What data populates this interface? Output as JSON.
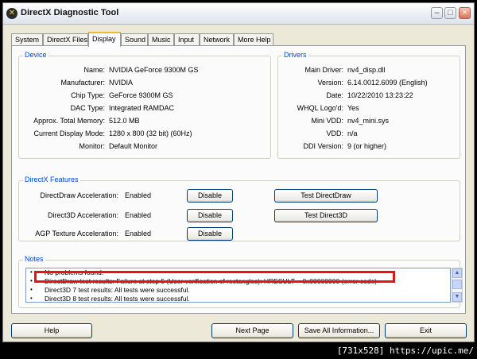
{
  "window": {
    "title": "DirectX Diagnostic Tool",
    "app_icon_glyph": "✕",
    "icons": [
      "directx-icon",
      "minimize-icon",
      "maximize-icon",
      "close-icon"
    ]
  },
  "tabs": [
    "System",
    "DirectX Files",
    "Display",
    "Sound",
    "Music",
    "Input",
    "Network",
    "More Help"
  ],
  "active_tab": "Display",
  "device": {
    "title": "Device",
    "rows": [
      {
        "label": "Name:",
        "value": "NVIDIA GeForce 9300M GS"
      },
      {
        "label": "Manufacturer:",
        "value": "NVIDIA"
      },
      {
        "label": "Chip Type:",
        "value": "GeForce 9300M GS"
      },
      {
        "label": "DAC Type:",
        "value": "Integrated RAMDAC"
      },
      {
        "label": "Approx. Total Memory:",
        "value": "512.0 MB"
      },
      {
        "label": "Current Display Mode:",
        "value": "1280 x 800 (32 bit) (60Hz)"
      },
      {
        "label": "Monitor:",
        "value": "Default Monitor"
      }
    ]
  },
  "drivers": {
    "title": "Drivers",
    "rows": [
      {
        "label": "Main Driver:",
        "value": "nv4_disp.dll"
      },
      {
        "label": "Version:",
        "value": "6.14.0012.6099 (English)"
      },
      {
        "label": "Date:",
        "value": "10/22/2010 13:23:22"
      },
      {
        "label": "WHQL Logo'd:",
        "value": "Yes"
      },
      {
        "label": "Mini VDD:",
        "value": "nv4_mini.sys"
      },
      {
        "label": "VDD:",
        "value": "n/a"
      },
      {
        "label": "DDI Version:",
        "value": "9 (or higher)"
      }
    ]
  },
  "features": {
    "title": "DirectX Features",
    "rows": [
      {
        "label": "DirectDraw Acceleration:",
        "value": "Enabled",
        "button": "Disable",
        "test_button": "Test DirectDraw"
      },
      {
        "label": "Direct3D Acceleration:",
        "value": "Enabled",
        "button": "Disable",
        "test_button": "Test Direct3D"
      },
      {
        "label": "AGP Texture Acceleration:",
        "value": "Enabled",
        "button": "Disable"
      }
    ]
  },
  "notes": {
    "title": "Notes",
    "bullet": "•",
    "lines": [
      "No problems found.",
      "DirectDraw test results: Failure at step 5 (User verification of rectangles): HRESULT = 0x00000000 (error code)",
      "Direct3D 7 test results: All tests were successful.",
      "Direct3D 8 test results: All tests were successful."
    ],
    "highlight_color": "#e31515"
  },
  "buttons": {
    "help": "Help",
    "next_page": "Next Page",
    "save_all": "Save All Information...",
    "exit": "Exit"
  },
  "watermark": "[731x528] https://upic.me/"
}
